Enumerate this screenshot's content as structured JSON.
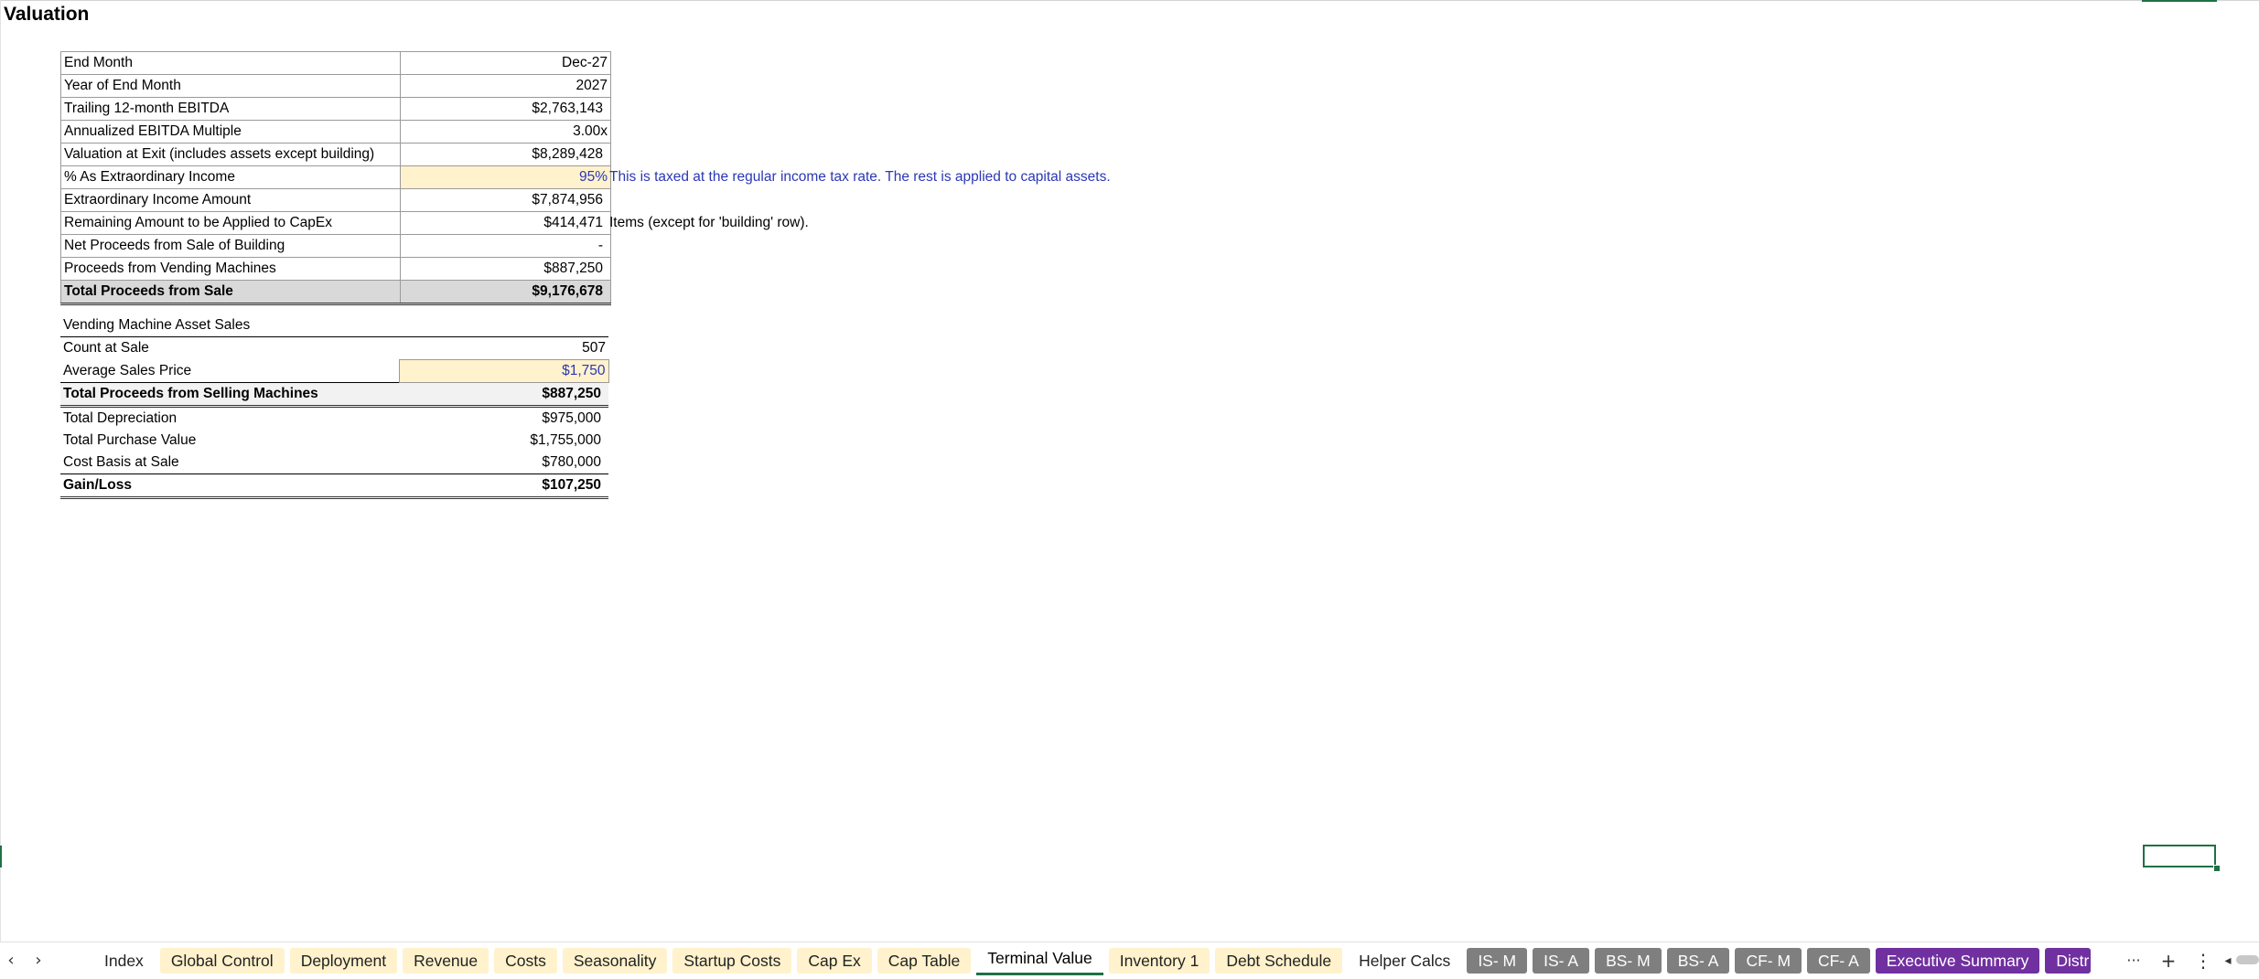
{
  "sheet": {
    "title": "Valuation"
  },
  "valuation_table": {
    "rows": [
      {
        "label": "End Month",
        "value": "Dec-27"
      },
      {
        "label": "Year of End Month",
        "value": "2027"
      },
      {
        "label": "Trailing 12-month EBITDA",
        "value": "$2,763,143"
      },
      {
        "label": "Annualized EBITDA Multiple",
        "value": "3.00x"
      },
      {
        "label": "Valuation at Exit (includes assets except building)",
        "value": "$8,289,428"
      },
      {
        "label": "% As Extraordinary Income",
        "value": "95%",
        "note": "This is taxed at the regular income tax rate. The rest is applied to capital assets."
      },
      {
        "label": "Extraordinary Income Amount",
        "value": "$7,874,956"
      },
      {
        "label": "Remaining Amount to be Applied to CapEx",
        "value": "$414,471",
        "note": "Items (except for 'building' row)."
      },
      {
        "label": "Net Proceeds from Sale of Building",
        "value": "-"
      },
      {
        "label": "Proceeds from Vending Machines",
        "value": "$887,250"
      },
      {
        "label": "Total Proceeds from Sale",
        "value": "$9,176,678"
      }
    ]
  },
  "vending_table": {
    "header": "Vending Machine Asset Sales",
    "rows": [
      {
        "label": "Count at Sale",
        "value": "507"
      },
      {
        "label": "Average Sales Price",
        "value": "$1,750"
      },
      {
        "label": "Total Proceeds from Selling Machines",
        "value": "$887,250"
      },
      {
        "label": "Total Depreciation",
        "value": "$975,000"
      },
      {
        "label": "Total Purchase Value",
        "value": "$1,755,000"
      },
      {
        "label": "Cost Basis at Sale",
        "value": "$780,000"
      },
      {
        "label": "Gain/Loss",
        "value": "$107,250"
      }
    ]
  },
  "tabs": [
    {
      "label": "Index",
      "style": "plain"
    },
    {
      "label": "Global Control",
      "style": "yellow"
    },
    {
      "label": "Deployment",
      "style": "yellow"
    },
    {
      "label": "Revenue",
      "style": "yellow"
    },
    {
      "label": "Costs",
      "style": "yellow"
    },
    {
      "label": "Seasonality",
      "style": "yellow"
    },
    {
      "label": "Startup Costs",
      "style": "yellow"
    },
    {
      "label": "Cap Ex",
      "style": "yellow"
    },
    {
      "label": "Cap Table",
      "style": "yellow"
    },
    {
      "label": "Terminal Value",
      "style": "active"
    },
    {
      "label": "Inventory 1",
      "style": "yellow"
    },
    {
      "label": "Debt Schedule",
      "style": "yellow"
    },
    {
      "label": "Helper Calcs",
      "style": "plain"
    },
    {
      "label": "IS- M",
      "style": "gray"
    },
    {
      "label": "IS- A",
      "style": "gray"
    },
    {
      "label": "BS- M",
      "style": "gray"
    },
    {
      "label": "BS- A",
      "style": "gray"
    },
    {
      "label": "CF- M",
      "style": "gray"
    },
    {
      "label": "CF- A",
      "style": "gray"
    },
    {
      "label": "Executive Summary",
      "style": "purple"
    },
    {
      "label": "Distr",
      "style": "purple"
    }
  ],
  "tab_controls": {
    "prev_icon": "chevron-left-icon",
    "next_icon": "chevron-right-icon",
    "prev_glyph": "‹",
    "next_glyph": "›",
    "more_glyph": "···",
    "add_glyph": "+",
    "options_glyph": "⋮",
    "scroll_left_glyph": "◂"
  },
  "colors": {
    "accent": "#1e7145",
    "input_fill": "#fff2cc",
    "input_text": "#2b38b5",
    "total_fill": "#d9d9d9",
    "tab_gray": "#7f7f7f",
    "tab_purple": "#7030a0"
  }
}
